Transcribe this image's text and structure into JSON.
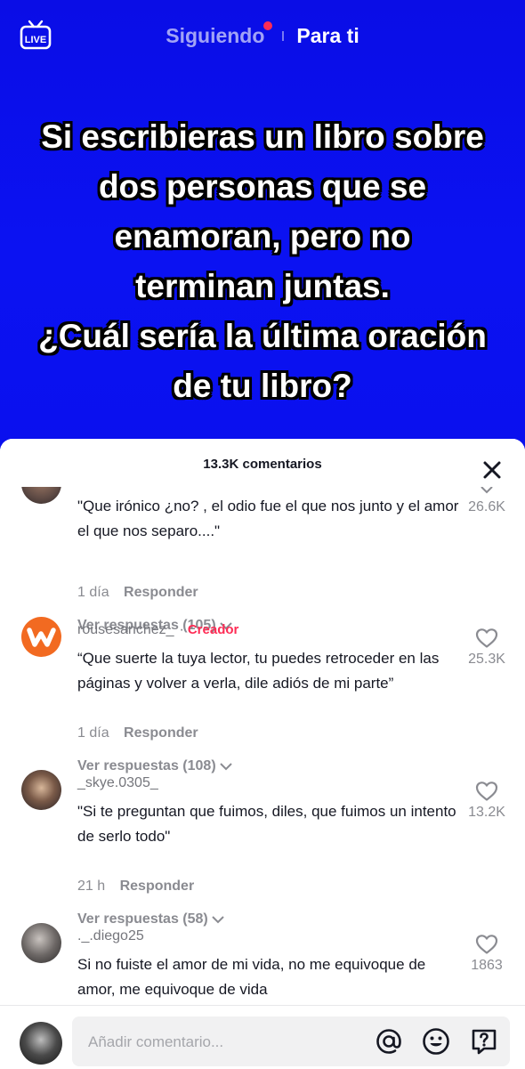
{
  "top_nav": {
    "following_label": "Siguiendo",
    "for_you_label": "Para ti",
    "live_label": "LIVE"
  },
  "video": {
    "caption": "Si escribieras un libro sobre\ndos personas que se\nenamoran, pero no\nterminan juntas.\n¿Cuál sería la última oración\nde tu libro?"
  },
  "comments_panel": {
    "count_label": "13.3K comentarios",
    "comments": [
      {
        "username": "",
        "text": "\"Que irónico ¿no? , el odio fue el que nos junto y el amor el que nos separo....\"",
        "time": "1 día",
        "reply_label": "Responder",
        "likes": "26.6K",
        "view_replies": "Ver respuestas (105)"
      },
      {
        "username": "rousesanchez_",
        "creator_badge": "Creador",
        "text": "“Que suerte la tuya lector, tu puedes retroceder en las páginas y volver a verla, dile adiós de mi parte”",
        "time": "1 día",
        "reply_label": "Responder",
        "likes": "25.3K",
        "view_replies": "Ver respuestas (108)"
      },
      {
        "username": "_skye.0305_",
        "text": "\"Si te preguntan que fuimos, diles, que fuimos un intento de serlo todo\"",
        "time": "21 h",
        "reply_label": "Responder",
        "likes": "13.2K",
        "view_replies": "Ver respuestas (58)"
      },
      {
        "username": "._.diego25",
        "text": "Si no fuiste el amor de mi vida, no me equivoque de amor, me equivoque de vida",
        "likes": "1863"
      }
    ]
  },
  "comment_input": {
    "placeholder": "Añadir comentario..."
  },
  "colors": {
    "video_background": "#0a0ef0",
    "accent": "#fe2c55",
    "secondary_text": "#8a8b91",
    "primary_text": "#161823"
  },
  "icons": {
    "live": "live-tv-icon",
    "close": "close-icon",
    "like": "heart-outline-icon",
    "mention": "at-sign-icon",
    "emoji": "emoji-icon",
    "question": "question-comment-icon"
  }
}
